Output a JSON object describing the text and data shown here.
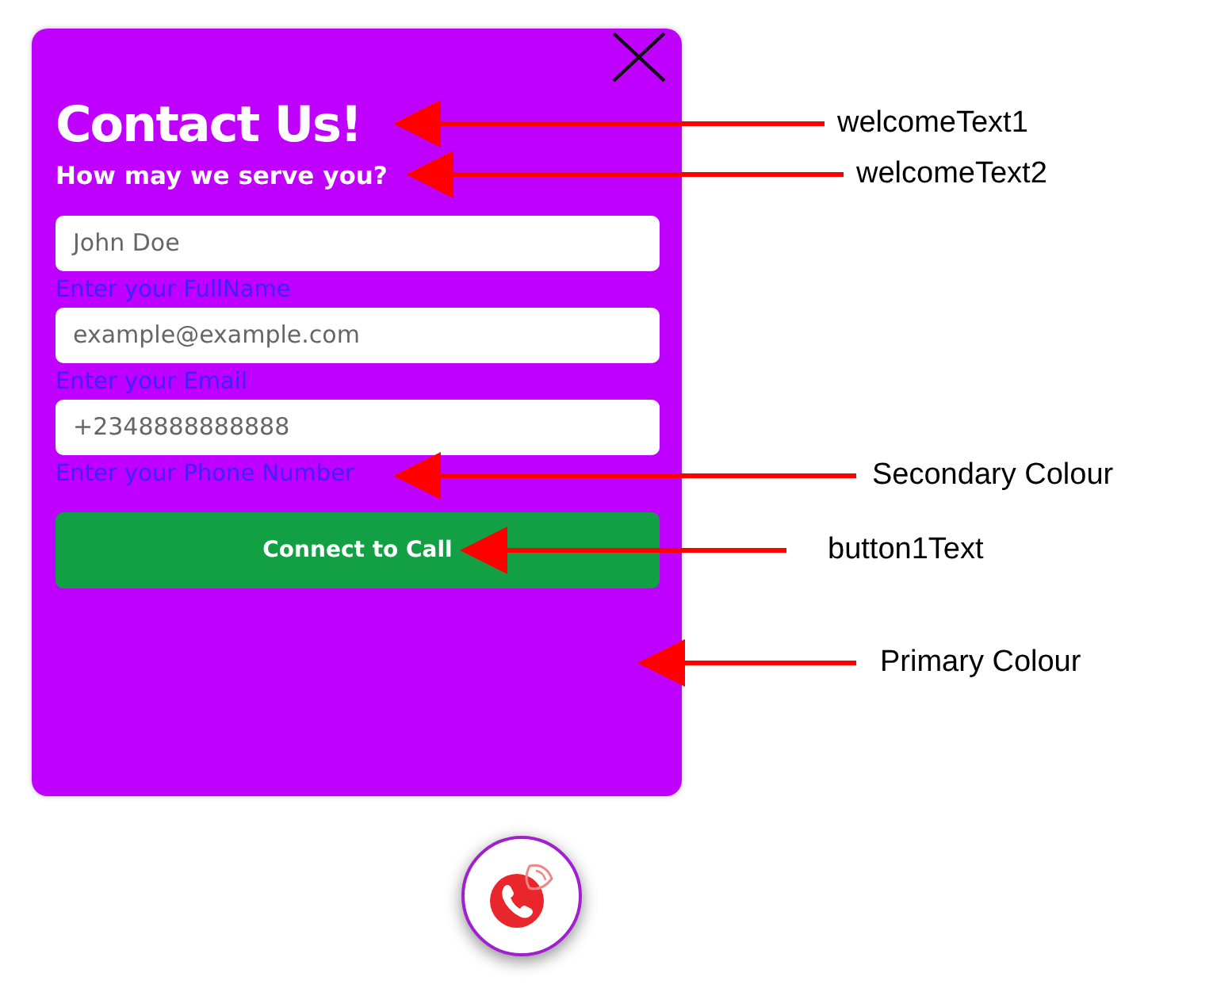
{
  "popup": {
    "title": "Contact Us!",
    "subtitle": "How may we serve you?",
    "fields": [
      {
        "placeholder": "John Doe",
        "hint": "Enter your FullName"
      },
      {
        "placeholder": "example@example.com",
        "hint": "Enter your Email"
      },
      {
        "placeholder": "+2348888888888",
        "hint": "Enter your Phone Number"
      }
    ],
    "button": "Connect to Call"
  },
  "annotations": [
    {
      "label": "welcomeText1"
    },
    {
      "label": "welcomeText2"
    },
    {
      "label": "Secondary Colour"
    },
    {
      "label": "button1Text"
    },
    {
      "label": "Primary Colour"
    }
  ]
}
